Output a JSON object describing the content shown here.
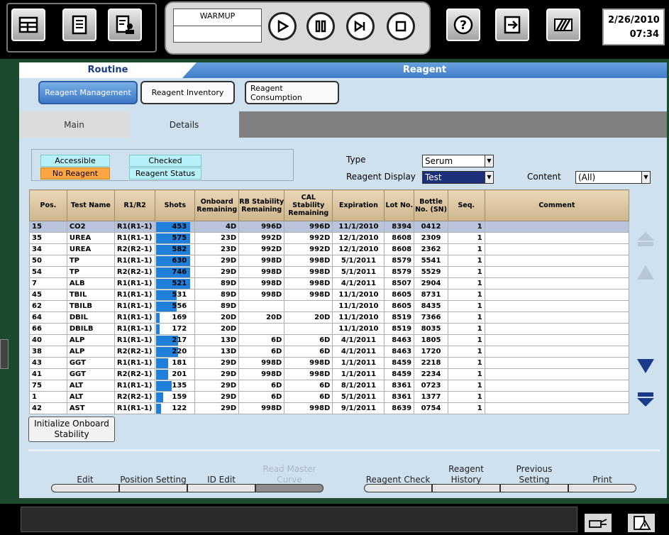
{
  "status": {
    "line1": "WARMUP",
    "line2": ""
  },
  "datetime": {
    "date": "2/26/2010",
    "time": "07:34"
  },
  "header": {
    "routine": "Routine",
    "reagent": "Reagent"
  },
  "subtabs": [
    "Reagent Management",
    "Reagent Inventory",
    "Reagent Consumption"
  ],
  "tabs": {
    "main": "Main",
    "details": "Details"
  },
  "legend": {
    "accessible": "Accessible",
    "checked": "Checked",
    "no_reagent": "No Reagent",
    "reagent_status": "Reagent Status"
  },
  "filters": {
    "type_label": "Type",
    "type_value": "Serum",
    "display_label": "Reagent Display",
    "display_value": "Test",
    "content_label": "Content",
    "content_value": "(All)"
  },
  "table": {
    "headers": [
      "Pos.",
      "Test Name",
      "R1/R2",
      "Shots",
      "Onboard Remaining",
      "RB Stability Remaining",
      "CAL Stability Remaining",
      "Expiration",
      "Lot No.",
      "Bottle No. (SN)",
      "Seq.",
      "Comment"
    ],
    "rows": [
      {
        "pos": "15",
        "test": "CO2",
        "r": "R1(R1-1)",
        "shots": "453",
        "shots_frac": 1.0,
        "onboard": "4D",
        "rb": "996D",
        "cal": "996D",
        "exp": "11/1/2010",
        "lot": "8394",
        "sn": "0412",
        "seq": "1"
      },
      {
        "pos": "35",
        "test": "UREA",
        "r": "R1(R1-1)",
        "shots": "575",
        "shots_frac": 1.0,
        "onboard": "23D",
        "rb": "992D",
        "cal": "992D",
        "exp": "12/1/2010",
        "lot": "8608",
        "sn": "2309",
        "seq": "1"
      },
      {
        "pos": "34",
        "test": "UREA",
        "r": "R2(R2-1)",
        "shots": "582",
        "shots_frac": 1.0,
        "onboard": "23D",
        "rb": "992D",
        "cal": "992D",
        "exp": "12/1/2010",
        "lot": "8608",
        "sn": "2362",
        "seq": "1"
      },
      {
        "pos": "50",
        "test": "TP",
        "r": "R1(R1-1)",
        "shots": "630",
        "shots_frac": 1.0,
        "onboard": "29D",
        "rb": "998D",
        "cal": "998D",
        "exp": "5/1/2011",
        "lot": "8579",
        "sn": "5541",
        "seq": "1"
      },
      {
        "pos": "54",
        "test": "TP",
        "r": "R2(R2-1)",
        "shots": "746",
        "shots_frac": 1.0,
        "onboard": "29D",
        "rb": "998D",
        "cal": "998D",
        "exp": "5/1/2011",
        "lot": "8579",
        "sn": "5529",
        "seq": "1"
      },
      {
        "pos": "7",
        "test": "ALB",
        "r": "R1(R1-1)",
        "shots": "521",
        "shots_frac": 1.0,
        "onboard": "89D",
        "rb": "998D",
        "cal": "998D",
        "exp": "4/1/2011",
        "lot": "8507",
        "sn": "2904",
        "seq": "1"
      },
      {
        "pos": "45",
        "test": "TBIL",
        "r": "R1(R1-1)",
        "shots": "531",
        "shots_frac": 0.6,
        "onboard": "89D",
        "rb": "998D",
        "cal": "998D",
        "exp": "11/1/2010",
        "lot": "8605",
        "sn": "8731",
        "seq": "1"
      },
      {
        "pos": "62",
        "test": "TBILB",
        "r": "R1(R1-1)",
        "shots": "556",
        "shots_frac": 0.6,
        "onboard": "89D",
        "rb": "",
        "cal": "",
        "exp": "11/1/2010",
        "lot": "8605",
        "sn": "8435",
        "seq": "1"
      },
      {
        "pos": "64",
        "test": "DBIL",
        "r": "R1(R1-1)",
        "shots": "169",
        "shots_frac": 0.1,
        "onboard": "20D",
        "rb": "20D",
        "cal": "20D",
        "exp": "11/1/2010",
        "lot": "8519",
        "sn": "7366",
        "seq": "1"
      },
      {
        "pos": "66",
        "test": "DBILB",
        "r": "R1(R1-1)",
        "shots": "172",
        "shots_frac": 0.1,
        "onboard": "20D",
        "rb": "",
        "cal": "",
        "exp": "11/1/2010",
        "lot": "8519",
        "sn": "8035",
        "seq": "1"
      },
      {
        "pos": "40",
        "test": "ALP",
        "r": "R1(R1-1)",
        "shots": "217",
        "shots_frac": 0.65,
        "onboard": "13D",
        "rb": "6D",
        "cal": "6D",
        "exp": "4/1/2011",
        "lot": "8463",
        "sn": "1805",
        "seq": "1"
      },
      {
        "pos": "38",
        "test": "ALP",
        "r": "R2(R2-1)",
        "shots": "220",
        "shots_frac": 0.65,
        "onboard": "13D",
        "rb": "6D",
        "cal": "6D",
        "exp": "4/1/2011",
        "lot": "8463",
        "sn": "1720",
        "seq": "1"
      },
      {
        "pos": "43",
        "test": "GGT",
        "r": "R1(R1-1)",
        "shots": "181",
        "shots_frac": 0.35,
        "onboard": "29D",
        "rb": "998D",
        "cal": "998D",
        "exp": "1/1/2011",
        "lot": "8459",
        "sn": "2218",
        "seq": "1"
      },
      {
        "pos": "41",
        "test": "GGT",
        "r": "R2(R2-1)",
        "shots": "201",
        "shots_frac": 0.35,
        "onboard": "29D",
        "rb": "998D",
        "cal": "998D",
        "exp": "1/1/2011",
        "lot": "8459",
        "sn": "2234",
        "seq": "1"
      },
      {
        "pos": "75",
        "test": "ALT",
        "r": "R1(R1-1)",
        "shots": "135",
        "shots_frac": 0.45,
        "onboard": "29D",
        "rb": "6D",
        "cal": "6D",
        "exp": "8/1/2011",
        "lot": "8361",
        "sn": "0723",
        "seq": "1"
      },
      {
        "pos": "1",
        "test": "ALT",
        "r": "R2(R2-1)",
        "shots": "159",
        "shots_frac": 0.2,
        "onboard": "29D",
        "rb": "6D",
        "cal": "6D",
        "exp": "5/1/2011",
        "lot": "8361",
        "sn": "1377",
        "seq": "1"
      },
      {
        "pos": "42",
        "test": "AST",
        "r": "R1(R1-1)",
        "shots": "122",
        "shots_frac": 0.15,
        "onboard": "29D",
        "rb": "998D",
        "cal": "998D",
        "exp": "9/1/2011",
        "lot": "8639",
        "sn": "0754",
        "seq": "1"
      }
    ]
  },
  "init_button": "Initialize Onboard Stability",
  "bottom_buttons": [
    {
      "label": "Edit",
      "enabled": true
    },
    {
      "label": "Position Setting",
      "enabled": true
    },
    {
      "label": "ID Edit",
      "enabled": true
    },
    {
      "label": "Read Master Curve",
      "enabled": false
    },
    {
      "label": "Reagent Check",
      "enabled": true
    },
    {
      "label": "Reagent History",
      "enabled": true
    },
    {
      "label": "Previous Setting",
      "enabled": true
    },
    {
      "label": "Print",
      "enabled": true
    }
  ],
  "colors": {
    "accessible": "#b8f0f8",
    "checked": "#b8f0f8",
    "no_reagent": "#ffa544",
    "reagent_status": "#b8f0f8",
    "selected_row": "#b9c3dc",
    "shot_bar": "#1f7fdb"
  }
}
